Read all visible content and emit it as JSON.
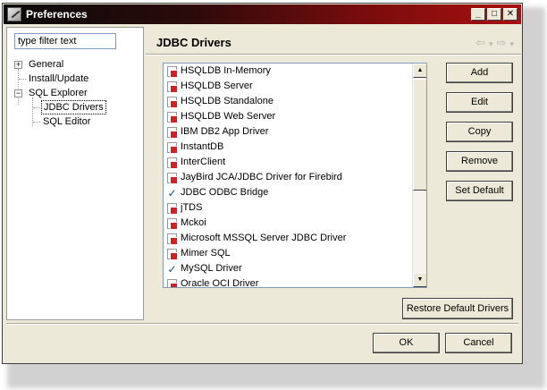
{
  "window": {
    "title": "Preferences",
    "controls": {
      "minimize": "_",
      "maximize": "□",
      "close": "✕"
    }
  },
  "left": {
    "filter_value": "type filter text",
    "tree": [
      {
        "label": "General",
        "expander": "+"
      },
      {
        "label": "Install/Update"
      },
      {
        "label": "SQL Explorer",
        "expander": "−"
      },
      {
        "label": "JDBC Drivers"
      },
      {
        "label": "SQL Editor"
      }
    ]
  },
  "page": {
    "title": "JDBC Drivers",
    "nav": {
      "back": "⇦",
      "back_menu": "▾",
      "forward": "⇨",
      "forward_menu": "▾"
    }
  },
  "drivers": [
    {
      "name": "HSQLDB In-Memory",
      "checked": false
    },
    {
      "name": "HSQLDB Server",
      "checked": false
    },
    {
      "name": "HSQLDB Standalone",
      "checked": false
    },
    {
      "name": "HSQLDB Web Server",
      "checked": false
    },
    {
      "name": "IBM DB2 App Driver",
      "checked": false
    },
    {
      "name": "InstantDB",
      "checked": false
    },
    {
      "name": "InterClient",
      "checked": false
    },
    {
      "name": "JayBird JCA/JDBC Driver for Firebird",
      "checked": false
    },
    {
      "name": "JDBC ODBC Bridge",
      "checked": true
    },
    {
      "name": "jTDS",
      "checked": false
    },
    {
      "name": "Mckoi",
      "checked": false
    },
    {
      "name": "Microsoft MSSQL Server JDBC Driver",
      "checked": false
    },
    {
      "name": "Mimer SQL",
      "checked": false
    },
    {
      "name": "MySQL Driver",
      "checked": true
    },
    {
      "name": "Oracle OCI Driver",
      "checked": false
    }
  ],
  "scroll": {
    "up": "▲",
    "down": "▼"
  },
  "buttons": {
    "add": "Add",
    "edit": "Edit",
    "copy": "Copy",
    "remove": "Remove",
    "set_default": "Set Default",
    "restore": "Restore Default Drivers",
    "ok": "OK",
    "cancel": "Cancel"
  },
  "colors": {
    "titlebar_start": "#0a0a0a",
    "titlebar_end": "#a81010",
    "driver_badge": "#d42020",
    "dialog_bg": "#ece9d8"
  }
}
